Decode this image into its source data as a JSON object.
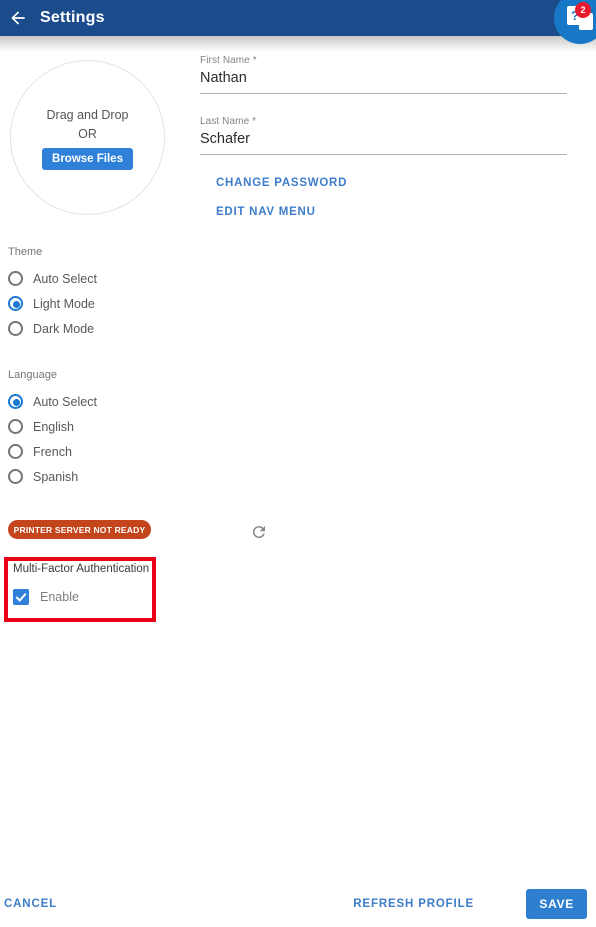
{
  "header": {
    "back_icon": "arrow-left-icon",
    "title": "Settings",
    "help_icon": "help-chat-icon",
    "help_badge": "2"
  },
  "upload": {
    "drag_text": "Drag and Drop",
    "or_text": "OR",
    "browse_label": "Browse Files"
  },
  "profile": {
    "first_name": {
      "label": "First Name *",
      "value": "Nathan",
      "placeholder": "First Name"
    },
    "last_name": {
      "label": "Last Name *",
      "value": "Schafer",
      "placeholder": "Last Name"
    },
    "change_password_label": "CHANGE PASSWORD",
    "edit_nav_menu_label": "EDIT NAV MENU"
  },
  "theme": {
    "title": "Theme",
    "options": [
      {
        "label": "Auto Select",
        "selected": false
      },
      {
        "label": "Light Mode",
        "selected": true
      },
      {
        "label": "Dark Mode",
        "selected": false
      }
    ]
  },
  "language": {
    "title": "Language",
    "options": [
      {
        "label": "Auto Select",
        "selected": true
      },
      {
        "label": "English",
        "selected": false
      },
      {
        "label": "French",
        "selected": false
      },
      {
        "label": "Spanish",
        "selected": false
      }
    ]
  },
  "printer_status": {
    "label": "PRINTER SERVER NOT READY",
    "color": "#c4441c"
  },
  "mfa": {
    "title": "Multi-Factor Authentication",
    "enable_label": "Enable",
    "enabled": true,
    "highlight_color": "#ea0016"
  },
  "spinner": {
    "icon": "refresh-spinner-icon"
  },
  "footer": {
    "cancel_label": "CANCEL",
    "refresh_profile_label": "REFRESH PROFILE",
    "save_label": "SAVE"
  },
  "colors": {
    "appbar": "#1c4b8c",
    "accent": "#2f80d8",
    "link": "#3d7dca"
  }
}
